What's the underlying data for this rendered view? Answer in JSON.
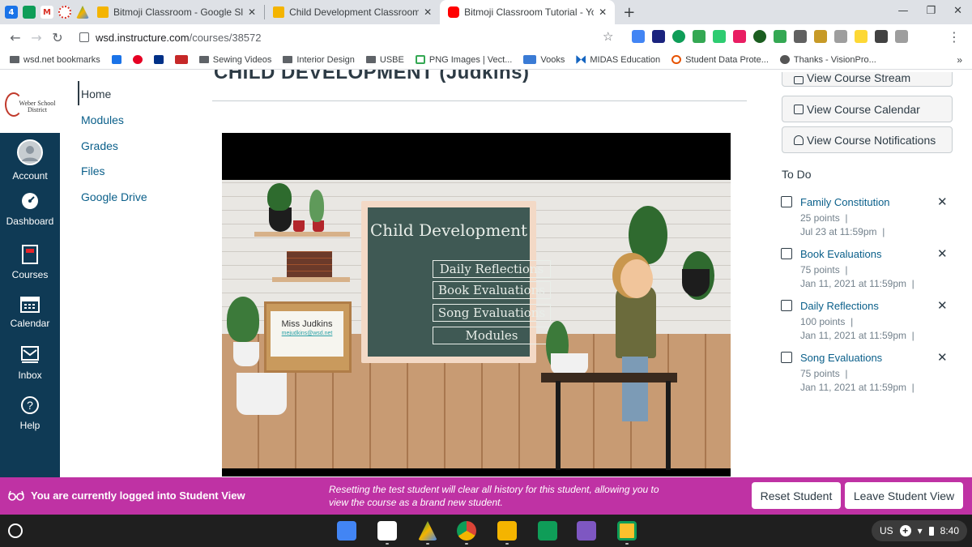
{
  "browser": {
    "tabs": [
      {
        "title": "Bitmoji Classroom - Google Slides",
        "fav_color": "#f4b400"
      },
      {
        "title": "Child Development Classroom Home",
        "fav_color": "#f4b400"
      },
      {
        "title": "Bitmoji Classroom Tutorial - YouTube",
        "fav_color": "#ff0000"
      }
    ],
    "pinned_tab_label": "4",
    "url_host": "wsd.instructure.com",
    "url_path": "/courses/38572",
    "bookmarks": [
      "wsd.net bookmarks",
      "Sewing Videos",
      "Interior Design",
      "USBE",
      "PNG Images | Vect...",
      "Vooks",
      "MIDAS Education",
      "Student Data Prote...",
      "Thanks - VisionPro..."
    ],
    "bookmarks_more": "»"
  },
  "global_nav": {
    "logo_text": "Weber School District",
    "items": [
      {
        "label": "Account"
      },
      {
        "label": "Dashboard"
      },
      {
        "label": "Courses"
      },
      {
        "label": "Calendar"
      },
      {
        "label": "Inbox"
      },
      {
        "label": "Help"
      }
    ]
  },
  "course_nav": {
    "items": [
      "Home",
      "Modules",
      "Grades",
      "Files",
      "Google Drive"
    ]
  },
  "content": {
    "page_title": "CHILD DEVELOPMENT (Judkins)",
    "hero": {
      "board_title": "Child Development",
      "board_links": [
        "Daily Reflections",
        "Book Evaluations",
        "Song Evaluations",
        "Modules"
      ],
      "note_name": "Miss Judkins",
      "note_email": "mejudkins@wsd.net"
    }
  },
  "sidebar": {
    "buttons": [
      "View Course Stream",
      "View Course Calendar",
      "View Course Notifications"
    ],
    "todo_heading": "To Do",
    "todo": [
      {
        "name": "Family Constitution",
        "points": "25 points",
        "due": "Jul 23 at 11:59pm"
      },
      {
        "name": "Book Evaluations",
        "points": "75 points",
        "due": "Jan 11, 2021 at 11:59pm"
      },
      {
        "name": "Daily Reflections",
        "points": "100 points",
        "due": "Jan 11, 2021 at 11:59pm"
      },
      {
        "name": "Song Evaluations",
        "points": "75 points",
        "due": "Jan 11, 2021 at 11:59pm"
      }
    ],
    "dismiss_glyph": "✕",
    "separator": "|"
  },
  "student_view": {
    "message": "You are currently logged into Student View",
    "info": "Resetting the test student will clear all history for this student, allowing you to view the course as a brand new student.",
    "reset_label": "Reset Student",
    "leave_label": "Leave Student View"
  },
  "os_shelf": {
    "locale": "US",
    "time": "8:40"
  },
  "colors": {
    "student_bar": "#bf32a4",
    "global_nav": "#0f3a55",
    "link": "#0a5f8a"
  }
}
